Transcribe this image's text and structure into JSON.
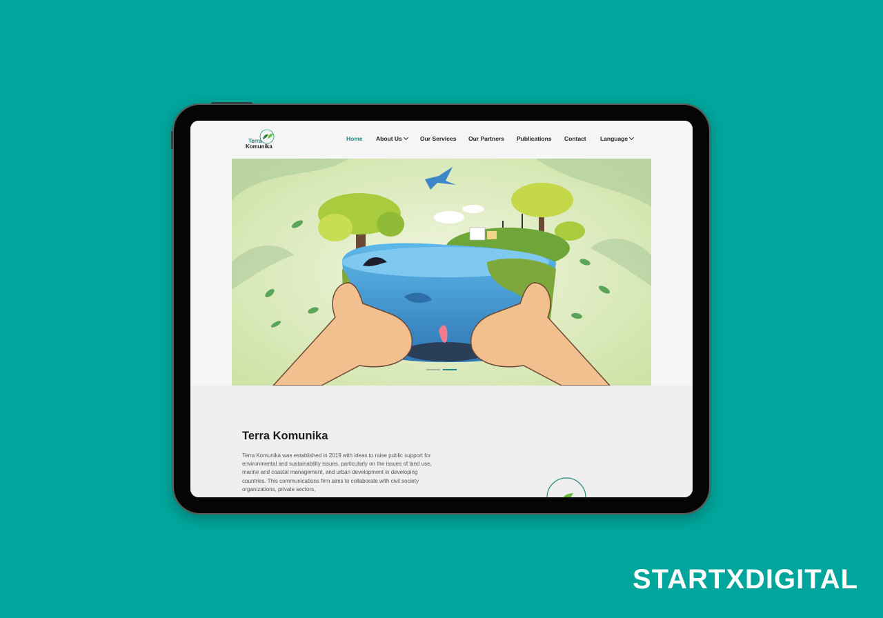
{
  "page": {
    "background_color": "#00a59b"
  },
  "brand": {
    "text": "STARTXDIGITAL"
  },
  "site": {
    "logo": {
      "line1": "Terra",
      "line2": "Komunika",
      "accent": "#1f8a7e"
    },
    "nav": {
      "home": "Home",
      "about": "About Us",
      "services": "Our Services",
      "partners": "Our Partners",
      "publications": "Publications",
      "contact": "Contact",
      "language": "Language",
      "active_color": "#1f8a7e"
    },
    "hero": {
      "illustration": "hands-holding-earth-ecosystem",
      "slider_dots": 2,
      "active_dot": 2
    },
    "about": {
      "title": "Terra Komunika",
      "text": "Terra Komunika was established in 2019 with ideas to raise public support for environmental and sustainability issues, particularly on the issues of land use, marine and coastal management, and urban development in developing countries. This communications firm aims to collaborate with civil society organizations, private sectors,"
    }
  }
}
